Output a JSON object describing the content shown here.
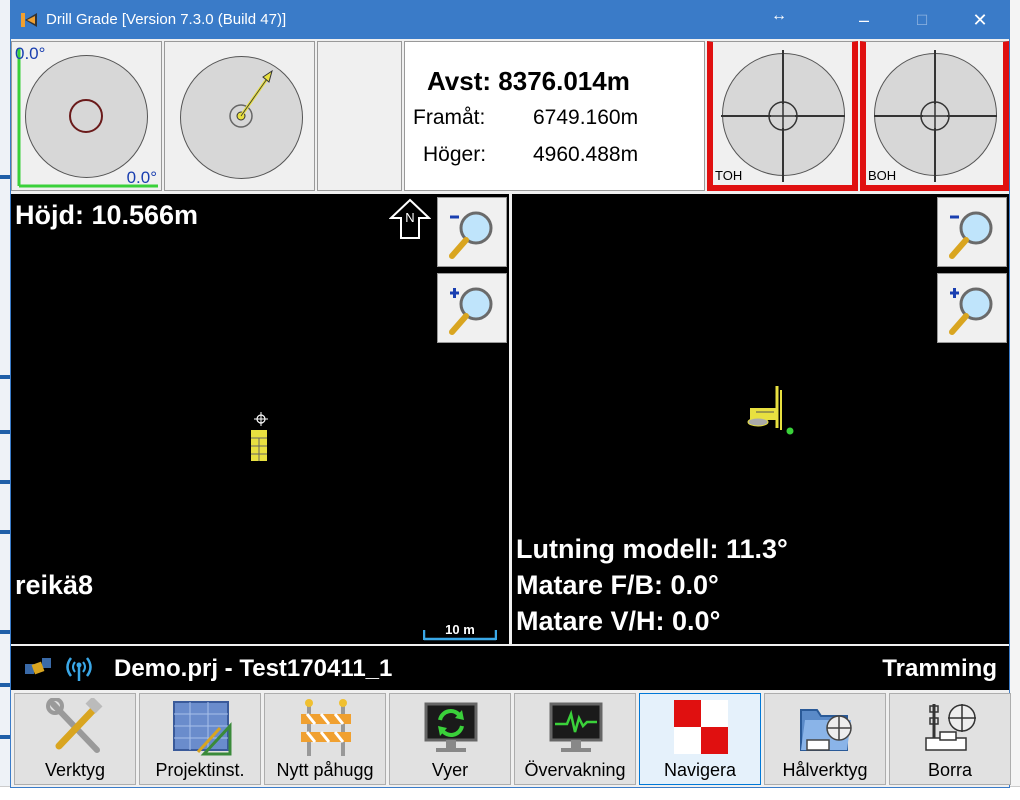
{
  "window": {
    "title": "Drill Grade [Version 7.3.0 (Build 47)]",
    "controls": {
      "resize": "↔",
      "minimize": "–",
      "maximize": "☐",
      "close": "✕"
    }
  },
  "top": {
    "tilt": {
      "angle_top": "0.0°",
      "angle_bottom": "0.0°"
    },
    "info": {
      "avst": "Avst: 8376.014m",
      "framat_label": "Framåt:",
      "framat_value": "6749.160m",
      "hoger_label": "Höger:",
      "hoger_value": "4960.488m"
    },
    "toh_label": "TOH",
    "boh_label": "BOH"
  },
  "left_view": {
    "height_text": "Höjd: 10.566m",
    "north_label": "N",
    "hole_name": "reikä8",
    "scale_label": "10 m"
  },
  "right_view": {
    "lutning": "Lutning modell: 11.3°",
    "matare_fb": "Matare F/B: 0.0°",
    "matare_vh": "Matare V/H: 0.0°"
  },
  "status": {
    "project": "Demo.prj - Test170411_1",
    "mode": "Tramming"
  },
  "toolbar": {
    "buttons": [
      {
        "label": "Verktyg",
        "icon": "tools-icon"
      },
      {
        "label": "Projektinst.",
        "icon": "project-settings-icon"
      },
      {
        "label": "Nytt påhugg",
        "icon": "barrier-icon"
      },
      {
        "label": "Vyer",
        "icon": "monitor-refresh-icon"
      },
      {
        "label": "Övervakning",
        "icon": "monitor-pulse-icon"
      },
      {
        "label": "Navigera",
        "icon": "checker-flag-icon"
      },
      {
        "label": "Hålverktyg",
        "icon": "hole-folder-icon"
      },
      {
        "label": "Borra",
        "icon": "drill-rig-icon"
      }
    ],
    "active": "Navigera"
  },
  "colors": {
    "titlebar": "#3a7bc8",
    "view_bg": "#000000",
    "accent_red": "#e01010",
    "accent_green": "#3ad13a",
    "rig_yellow": "#e8e040"
  }
}
